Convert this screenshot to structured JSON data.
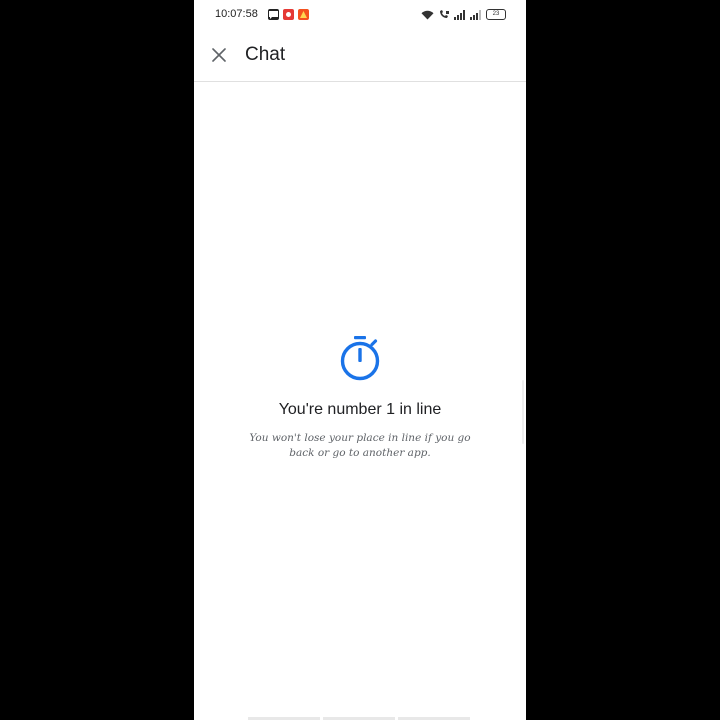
{
  "status_bar": {
    "time": "10:07:58",
    "battery_level": "23",
    "notification_icons": [
      "message-icon",
      "record-icon",
      "app-alert-icon"
    ],
    "system_icons": [
      "wifi-icon",
      "volte-icon",
      "signal-icon",
      "signal-icon-2",
      "battery-icon"
    ]
  },
  "app_bar": {
    "title": "Chat",
    "close_icon": "close-icon"
  },
  "queue": {
    "icon": "stopwatch-icon",
    "title": "You're number 1 in line",
    "message": "You won't lose your place in line if you go back or go to another app.",
    "accent_color": "#1a73e8"
  }
}
